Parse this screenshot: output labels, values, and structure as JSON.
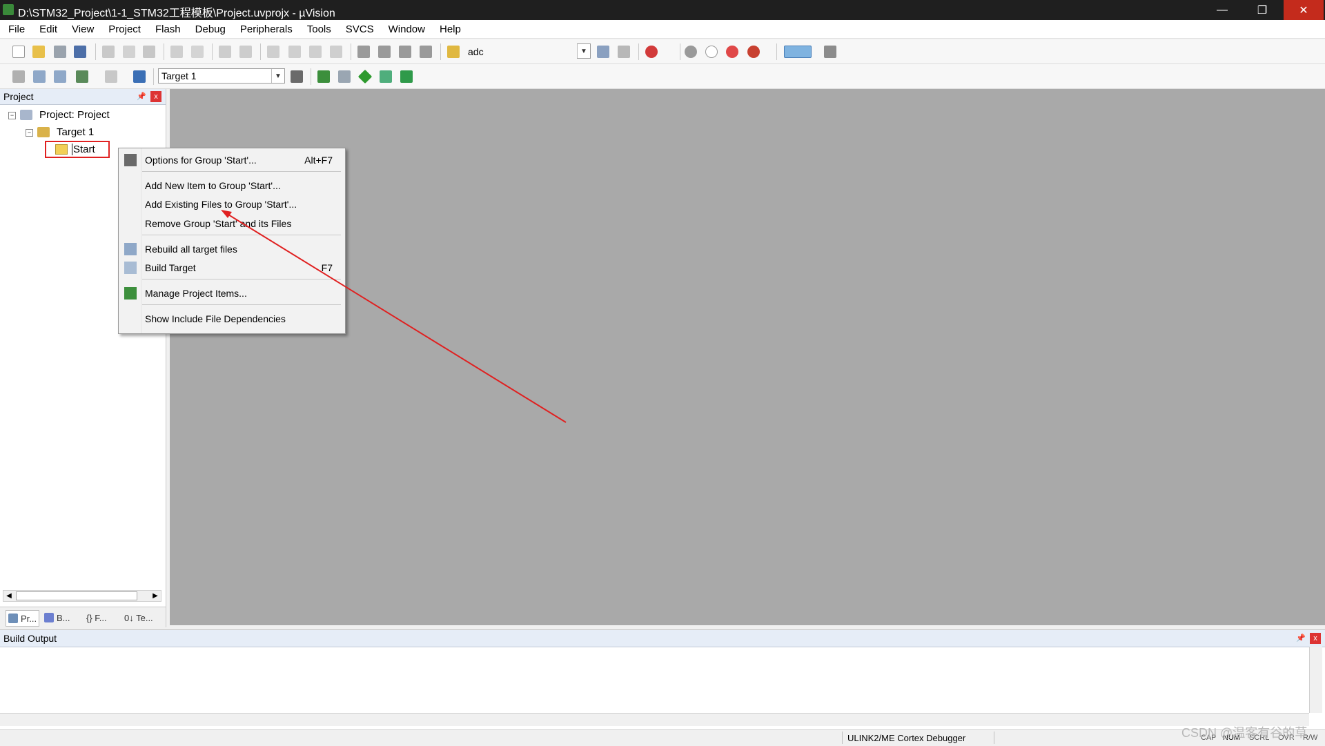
{
  "window": {
    "title": "D:\\STM32_Project\\1-1_STM32工程模板\\Project.uvprojx - µVision",
    "minimize": "—",
    "maximize": "❐",
    "close": "✕"
  },
  "menubar": [
    "File",
    "Edit",
    "View",
    "Project",
    "Flash",
    "Debug",
    "Peripherals",
    "Tools",
    "SVCS",
    "Window",
    "Help"
  ],
  "toolbar": {
    "find_text": "adc",
    "target_select": "Target 1",
    "dropdown_glyph": "▼"
  },
  "project_panel": {
    "title": "Project",
    "pin": "📌",
    "close": "x",
    "tree": {
      "root_label": "Project: Project",
      "target_label": "Target 1",
      "group_label": "Start",
      "expander_glyph": "−"
    },
    "tabs": [
      "Pr...",
      "B...",
      "{} F...",
      "0↓ Te..."
    ],
    "scroll_left": "◀",
    "scroll_right": "▶"
  },
  "context_menu": {
    "items": [
      {
        "label": "Options for Group 'Start'...",
        "shortcut": "Alt+F7",
        "icon": "options-wand-icon"
      },
      {
        "label": "Add New  Item to Group 'Start'...",
        "shortcut": ""
      },
      {
        "label": "Add Existing Files to Group 'Start'...",
        "shortcut": ""
      },
      {
        "label": "Remove Group 'Start' and its Files",
        "shortcut": ""
      },
      {
        "label": "Rebuild all target files",
        "shortcut": "",
        "icon": "rebuild-icon"
      },
      {
        "label": "Build Target",
        "shortcut": "F7",
        "icon": "build-icon"
      },
      {
        "label": "Manage Project Items...",
        "shortcut": "",
        "icon": "manage-project-items-icon"
      },
      {
        "label": "Show Include File Dependencies",
        "shortcut": ""
      }
    ]
  },
  "build_output": {
    "title": "Build Output",
    "pin": "📌",
    "close": "x"
  },
  "statusbar": {
    "debugger": "ULINK2/ME Cortex Debugger",
    "indicators": [
      "CAP",
      "NUM",
      "SCRL",
      "OVR",
      "R/W"
    ]
  },
  "watermark": "CSDN @温客有谷的草",
  "colors": {
    "titlebar": "#1f1f1f",
    "close_button": "#c42b1c",
    "editor_background": "#a9a9a9",
    "highlight_box": "#e02020",
    "annotation_arrow": "#e02020"
  }
}
